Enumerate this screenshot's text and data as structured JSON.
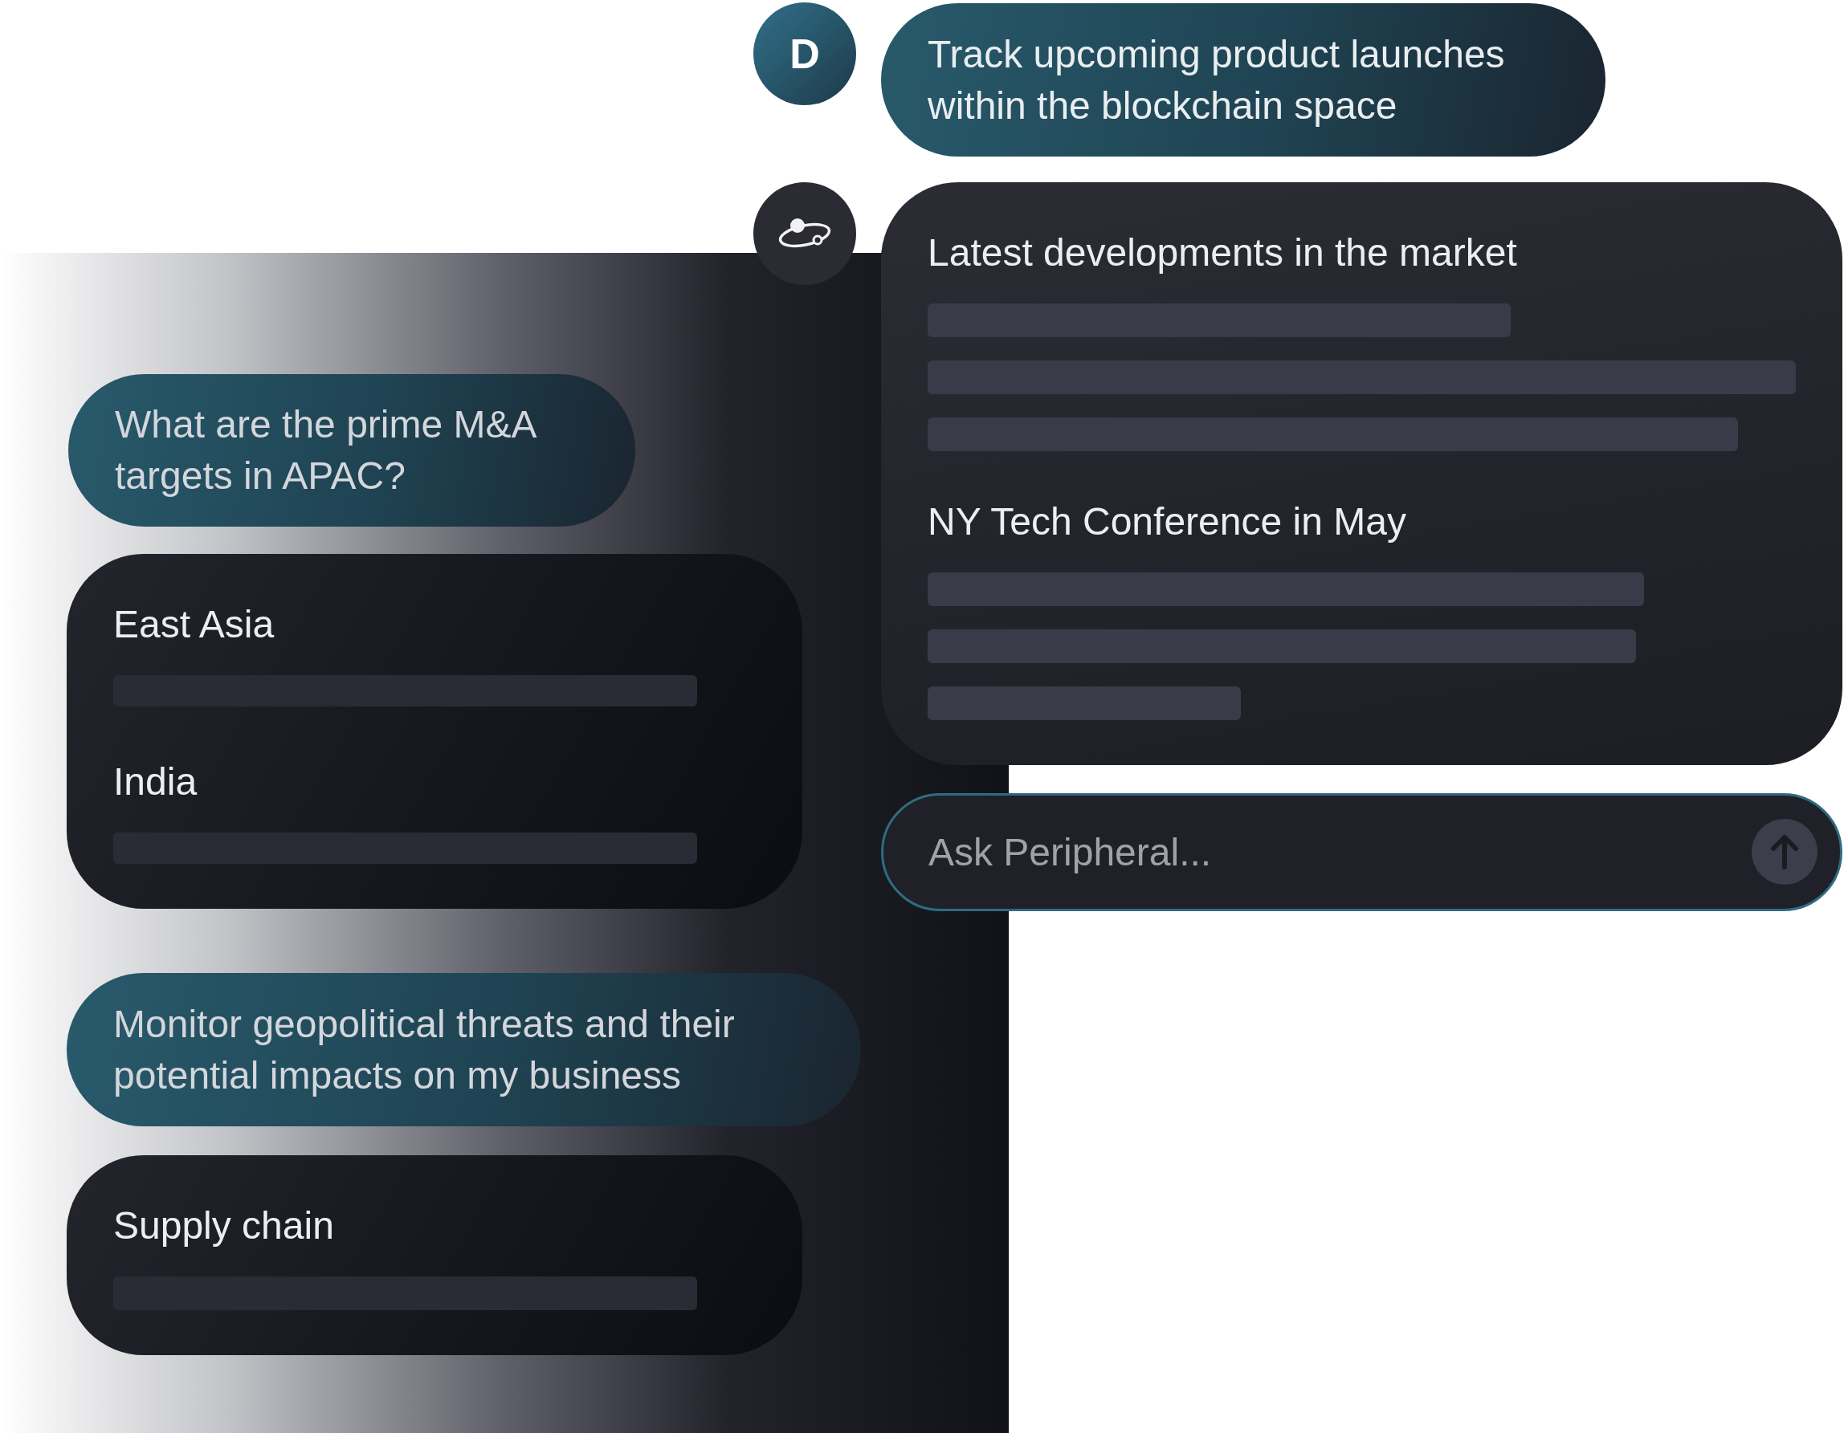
{
  "left_panel": {
    "items": [
      {
        "kind": "prompt",
        "text": "What are the prime M&A targets in APAC?"
      },
      {
        "kind": "result",
        "sections": [
          {
            "title": "East Asia"
          },
          {
            "title": "India"
          }
        ]
      },
      {
        "kind": "prompt",
        "text": "Monitor geopolitical threats and their potential impacts on my business"
      },
      {
        "kind": "result",
        "sections": [
          {
            "title": "Supply chain"
          }
        ]
      }
    ]
  },
  "chat": {
    "user_avatar": {
      "initial": "D"
    },
    "user_message": "Track upcoming product launches within the blockchain space",
    "response": {
      "sections": [
        {
          "title": "Latest developments in the market"
        },
        {
          "title": "NY Tech Conference in May"
        }
      ]
    },
    "input": {
      "placeholder": "Ask Peripheral..."
    }
  }
}
